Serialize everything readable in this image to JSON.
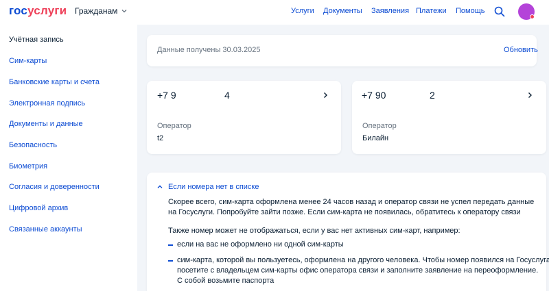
{
  "header": {
    "logo_part1": "гос",
    "logo_part2": "услуги",
    "audience_label": "Гражданам",
    "nav": [
      "Услуги",
      "Документы",
      "Заявления",
      "Платежи",
      "Помощь"
    ]
  },
  "sidebar": {
    "items": [
      {
        "label": "Учётная запись"
      },
      {
        "label": "Сим-карты"
      },
      {
        "label": "Банковские карты и счета"
      },
      {
        "label": "Электронная подпись"
      },
      {
        "label": "Документы и данные"
      },
      {
        "label": "Безопасность"
      },
      {
        "label": "Биометрия"
      },
      {
        "label": "Согласия и доверенности"
      },
      {
        "label": "Цифровой архив"
      },
      {
        "label": "Связанные аккаунты"
      }
    ]
  },
  "status": {
    "text": "Данные получены 30.03.2025",
    "refresh_label": "Обновить"
  },
  "sim_cards": [
    {
      "number_prefix": "+7 9",
      "number_suffix": "4",
      "operator_label": "Оператор",
      "operator": "t2"
    },
    {
      "number_prefix": "+7 90",
      "number_suffix": "2",
      "operator_label": "Оператор",
      "operator": "Билайн"
    }
  ],
  "faq": {
    "title": "Если номера нет в списке",
    "para1_line1": "Скорее всего, сим-карта оформлена менее 24 часов назад и оператор связи не успел передать данные",
    "para1_line2": "на Госуслуги. Попробуйте зайти позже. Если сим-карта не появилась, обратитесь к оператору связи",
    "para2": "Также номер может не отображаться, если у вас нет активных сим-карт, например:",
    "bullet1": "если на вас не оформлено ни одной сим-карты",
    "bullet2_line1": "сим-карта, которой вы пользуетесь, оформлена на другого человека. Чтобы номер появился на Госуслугах,",
    "bullet2_line2": "посетите с владельцем сим-карты офис оператора связи и заполните заявление на переоформление.",
    "bullet2_line3": "С собой возьмите паспорта"
  },
  "colors": {
    "brand_blue": "#0d4cd3",
    "brand_red": "#ee3f58",
    "avatar": "#b443d9",
    "background": "#f2f5f9"
  }
}
